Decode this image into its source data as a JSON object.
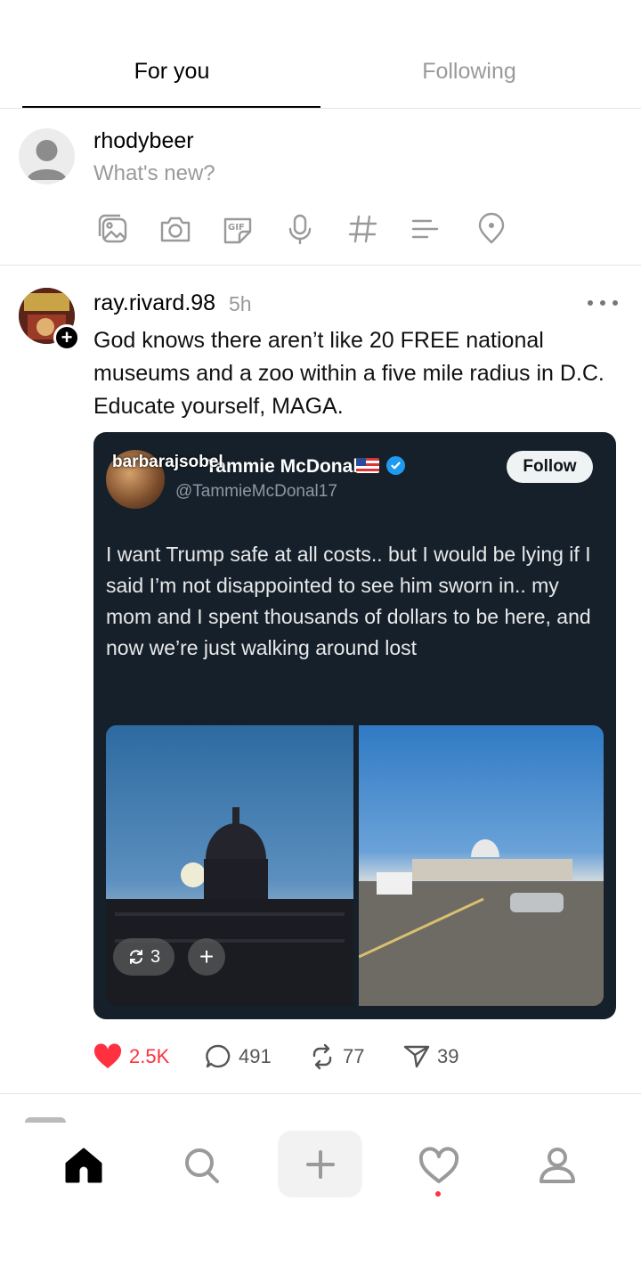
{
  "tabs": [
    {
      "label": "For you",
      "active": true
    },
    {
      "label": "Following",
      "active": false
    }
  ],
  "composer": {
    "username": "rhodybeer",
    "placeholder": "What's new?",
    "tools": [
      "gallery-icon",
      "camera-icon",
      "gif-icon",
      "microphone-icon",
      "hashtag-icon",
      "poll-icon",
      "location-icon"
    ]
  },
  "post": {
    "author": "ray.rivard.98",
    "time": "5h",
    "text": "God knows there aren’t like 20 FREE national museums and a zoo within a five mile radius in D.C. Educate yourself, MAGA.",
    "embed": {
      "watermark": "barbarajsobel",
      "name": "Tammie McDonald",
      "handle": "@TammieMcDonal17",
      "follow_label": "Follow",
      "body": "I want Trump safe at all costs.. but I would be lying if I said I’m not disappointed to see him sworn in.. my mom and I spent thousands of dollars to be here, and now we’re just walking around lost",
      "repost_count": "3",
      "plus_label": "+"
    },
    "stats": {
      "likes": "2.5K",
      "replies": "491",
      "reposts": "77",
      "shares": "39"
    }
  },
  "nav": {
    "create_label": "+",
    "items": [
      "home-icon",
      "search-icon",
      "create-icon",
      "activity-icon",
      "profile-icon"
    ]
  },
  "colors": {
    "like": "#ff3040",
    "embed_bg": "#16202a",
    "muted": "#9a9a9a"
  }
}
